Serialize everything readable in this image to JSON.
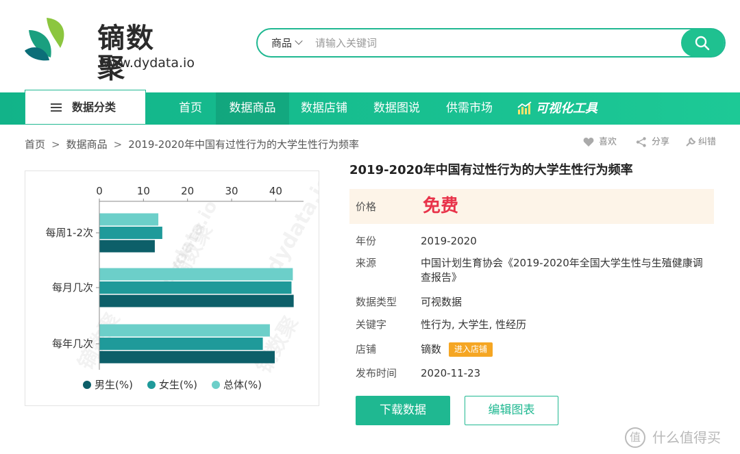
{
  "brand": {
    "name_cn": "镝数聚",
    "url": "www.dydata.io"
  },
  "search": {
    "category": "商品",
    "placeholder": "请输入关键词"
  },
  "nav": {
    "category_label": "数据分类",
    "items": [
      "首页",
      "数据商品",
      "数据店铺",
      "数据图说",
      "供需市场"
    ],
    "active_index": 1,
    "vis_tool": "可视化工具"
  },
  "breadcrumb": [
    "首页",
    "数据商品",
    "2019-2020年中国有过性行为的大学生性行为频率"
  ],
  "actions": {
    "like": "喜欢",
    "share": "分享",
    "report": "纠错"
  },
  "detail": {
    "title": "2019-2020年中国有过性行为的大学生性行为频率",
    "price_label": "价格",
    "price_value": "免费",
    "rows": [
      {
        "label": "年份",
        "value": "2019-2020"
      },
      {
        "label": "来源",
        "value": "中国计划生育协会《2019-2020年全国大学生性与生殖健康调查报告》"
      },
      {
        "label": "数据类型",
        "value": "可视数据"
      },
      {
        "label": "关键字",
        "value": "性行为, 大学生, 性经历"
      },
      {
        "label": "店铺",
        "value": "镝数"
      },
      {
        "label": "发布时间",
        "value": "2020-11-23"
      }
    ],
    "shop_badge": "进入店铺",
    "download_label": "下载数据",
    "edit_label": "编辑图表"
  },
  "watermark": {
    "cn": "镝数聚",
    "en": "dydata.io"
  },
  "footer_watermark": {
    "icon": "值",
    "text": "什么值得买"
  },
  "colors": {
    "accent": "#1fb891",
    "male": "#0d5f69",
    "female": "#1f9a9a",
    "total": "#6ccfc9",
    "price": "#e8334a",
    "badge": "#f5a623"
  },
  "chart_data": {
    "type": "bar",
    "orientation": "horizontal",
    "categories": [
      "每周1-2次",
      "每月几次",
      "每年几次"
    ],
    "series": [
      {
        "name": "男生(%)",
        "values": [
          12.5,
          44,
          39.7
        ]
      },
      {
        "name": "女生(%)",
        "values": [
          14.2,
          43.5,
          37
        ]
      },
      {
        "name": "总体(%)",
        "values": [
          13.3,
          43.8,
          38.6
        ]
      }
    ],
    "xticks": [
      0,
      10,
      20,
      30,
      40
    ],
    "xlim": [
      0,
      46
    ],
    "axis_position": "top",
    "legend": "bottom",
    "grid": false
  }
}
